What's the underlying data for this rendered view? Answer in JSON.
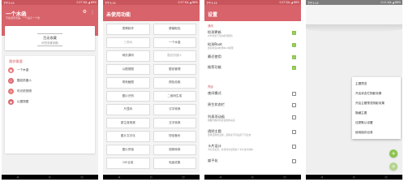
{
  "colors": {
    "accent": "#d8636a",
    "status_bar": "#c9555c",
    "checkbox_on": "#8bc34a",
    "fab": "#8bc34a"
  },
  "phone1": {
    "status_time": "下午3:19",
    "status_right": "0.27 K/s ◢ 86%",
    "app_title": "一个木函",
    "app_subtitle": "不失远风无是，一个盒子一个世",
    "card_main": "百无收藏",
    "card_sub": "（可在设置设置）",
    "list_header": "猜你需要",
    "items": [
      {
        "label": "一个木盒",
        "icon": "box-icon",
        "color": "#e57373"
      },
      {
        "label": "酷炫机器人",
        "icon": "robot-icon",
        "color": "#d8636a"
      },
      {
        "label": "时光机快照",
        "icon": "clock-icon",
        "color": "#e57373"
      },
      {
        "label": "以图搜图",
        "icon": "image-search-icon",
        "color": "#d8636a"
      }
    ]
  },
  "phone2": {
    "status_time": "下午3:19",
    "status_right": "0.27 K/s ◢ 86%",
    "title": "未使用功能",
    "cells": [
      {
        "label": "表情制作",
        "dim": false
      },
      {
        "label": "屏幕取色",
        "dim": false
      },
      {
        "label": "三角动",
        "dim": true
      },
      {
        "label": "一个木盒",
        "dim": false
      },
      {
        "label": "网页源码",
        "dim": false
      },
      {
        "label": "酷炫机器人",
        "dim": true
      },
      {
        "label": "以图搜图",
        "dim": false
      },
      {
        "label": "壁纸管理",
        "dim": false
      },
      {
        "label": "带壳截图",
        "dim": false
      },
      {
        "label": "颜色拾取",
        "dim": false
      },
      {
        "label": "图片识别",
        "dim": false
      },
      {
        "label": "二维码生成",
        "dim": false
      },
      {
        "label": "尺显码",
        "dim": false
      },
      {
        "label": "汉字转换",
        "dim": false
      },
      {
        "label": "原生音视频",
        "dim": false
      },
      {
        "label": "文字转换",
        "dim": false
      },
      {
        "label": "图片文字化",
        "dim": false
      },
      {
        "label": "短信备份",
        "dim": false
      },
      {
        "label": "图片拼接",
        "dim": false
      },
      {
        "label": "视频转换",
        "dim": false
      },
      {
        "label": "GIF合成",
        "dim": false
      },
      {
        "label": "电量收集",
        "dim": false
      }
    ]
  },
  "phone3": {
    "status_time": "下午3:19",
    "status_right": "0.27 K/s ◢ 86%",
    "title": "设置",
    "section1": "通用",
    "rows1": [
      {
        "title": "检测更新",
        "sub": "WiFi状态下自动检测更新",
        "on": true
      },
      {
        "title": "检测Root",
        "sub": "启动时自动检测Root权限",
        "on": true
      },
      {
        "title": "最近使用",
        "sub": "",
        "on": true
      },
      {
        "title": "推荐功能",
        "sub": "",
        "on": true
      }
    ],
    "section2": "界面",
    "rows2": [
      {
        "title": "夜间模式",
        "sub": "",
        "on": false
      },
      {
        "title": "原生状态栏",
        "sub": "",
        "on": false
      },
      {
        "title": "列表项动画",
        "sub": "收藏与推荐列表使用的动画",
        "on": false
      },
      {
        "title": "透明主题",
        "sub": "选择应用的主题，选项在不同主题下不生效",
        "on": false
      },
      {
        "title": "卡片设计",
        "sub": "卡片式主页，支持同时出现多个卡片进行排布",
        "on": false
      },
      {
        "title": "扁平化",
        "sub": "",
        "on": false
      }
    ]
  },
  "phone4": {
    "status_time": "下午3:19",
    "status_right": "0.11 K/s ◢ 86%",
    "menu": [
      "主题预览",
      "开启状态栏阴影效果",
      "开启主题预览阴影效果",
      "隐藏主图",
      "还原默认设置",
      "使用保存目录"
    ],
    "fab_icon": "plus-icon"
  }
}
